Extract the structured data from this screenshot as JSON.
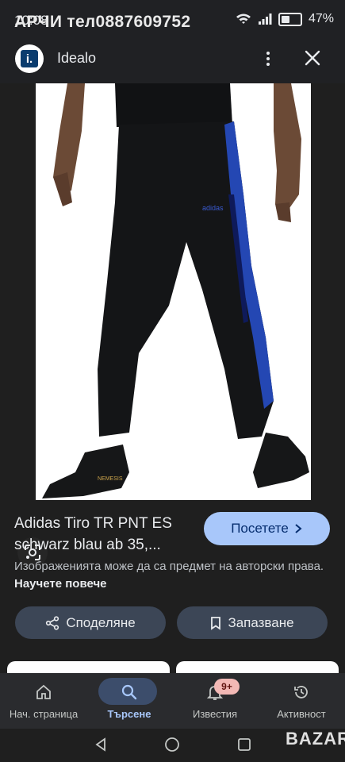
{
  "status_bar": {
    "time": "10:08",
    "overlay_text": "АРЧИ тел0887609752",
    "battery_percent": "47%",
    "battery_level": 0.47
  },
  "app_bar": {
    "logo_letter": "i.",
    "title": "Idealo",
    "more_icon": "more-vert-icon",
    "close_icon": "close-icon"
  },
  "image": {
    "brand_on_product": "NEMESIS",
    "logo_text": "adidas",
    "lens_icon": "google-lens-icon"
  },
  "product": {
    "title": "Adidas Tiro TR PNT ES schwarz blau ab 35,...",
    "visit_label": "Посетете",
    "copyright_text": "Изображенията може да са предмет на авторски права.",
    "learn_more": "Научете повече"
  },
  "actions": {
    "share_label": "Споделяне",
    "save_label": "Запазване"
  },
  "bottom_nav": {
    "items": [
      {
        "label": "Нач. страница",
        "icon": "home-icon"
      },
      {
        "label": "Търсене",
        "icon": "search-icon",
        "active": true
      },
      {
        "label": "Известия",
        "icon": "bell-icon",
        "badge": "9+"
      },
      {
        "label": "Активност",
        "icon": "history-icon"
      }
    ]
  },
  "watermark": "BAZAR",
  "colors": {
    "background": "#1f1f1f",
    "accent": "#a8c7fa",
    "pants_stripe": "#2447b3",
    "pants": "#141517"
  }
}
